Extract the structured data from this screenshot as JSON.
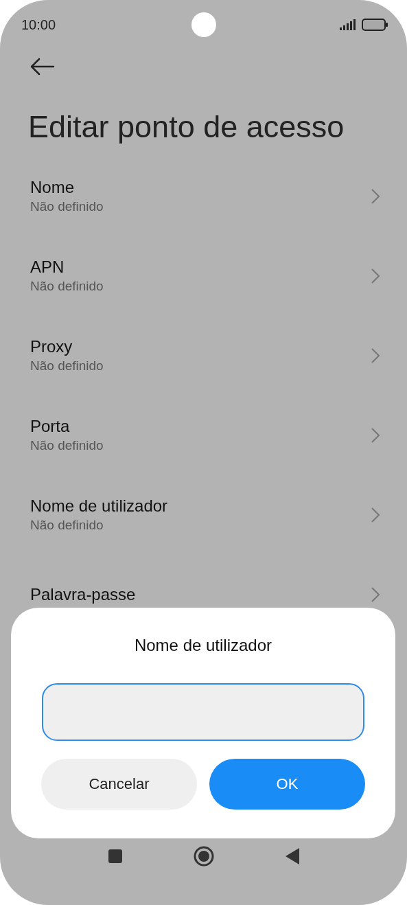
{
  "status_bar": {
    "time": "10:00"
  },
  "title": "Editar ponto de acesso",
  "items": [
    {
      "label": "Nome",
      "value": "Não definido"
    },
    {
      "label": "APN",
      "value": "Não definido"
    },
    {
      "label": "Proxy",
      "value": "Não definido"
    },
    {
      "label": "Porta",
      "value": "Não definido"
    },
    {
      "label": "Nome de utilizador",
      "value": "Não definido"
    },
    {
      "label": "Palavra-passe"
    }
  ],
  "dialog": {
    "title": "Nome de utilizador",
    "input": {
      "focused": true
    },
    "buttons": [
      {
        "label": "Cancelar",
        "kind": "secondary"
      },
      {
        "label": "OK",
        "kind": "primary"
      }
    ]
  }
}
